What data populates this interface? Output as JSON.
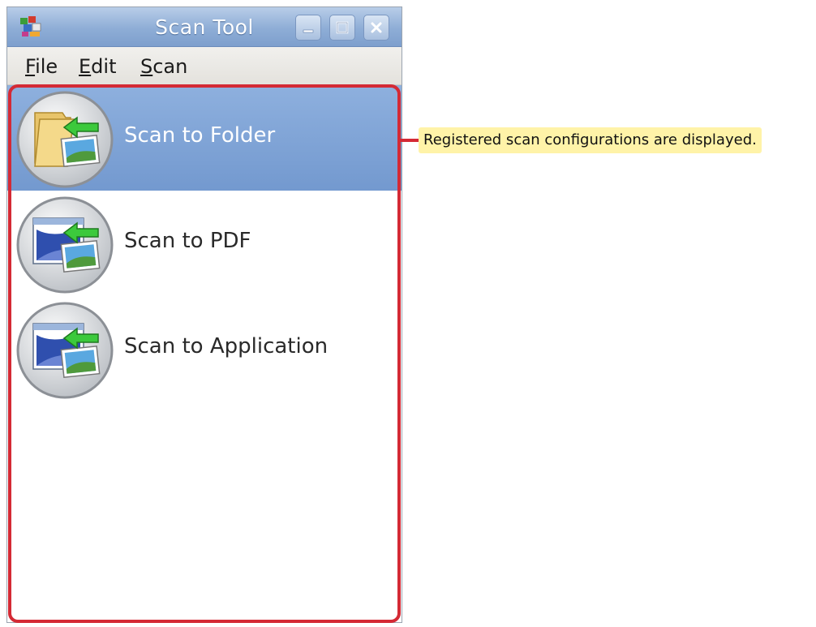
{
  "window": {
    "title": "Scan Tool",
    "controls": {
      "minimize": "minimize",
      "maximize": "maximize",
      "close": "close"
    }
  },
  "menu": [
    {
      "mnemonic": "F",
      "rest": "ile"
    },
    {
      "mnemonic": "E",
      "rest": "dit"
    },
    {
      "mnemonic": "S",
      "rest": "can"
    }
  ],
  "configurations": [
    {
      "label": "Scan to Folder",
      "icon": "scan-to-folder-icon",
      "selected": true
    },
    {
      "label": "Scan to PDF",
      "icon": "scan-to-pdf-icon",
      "selected": false
    },
    {
      "label": "Scan to Application",
      "icon": "scan-to-application-icon",
      "selected": false
    }
  ],
  "annotation": {
    "text": "Registered scan configurations are displayed.",
    "color": "#d42a35",
    "background": "#fff3a8"
  },
  "colors": {
    "selection": "#7fa3d6",
    "titlebar": "#8eadd6"
  }
}
